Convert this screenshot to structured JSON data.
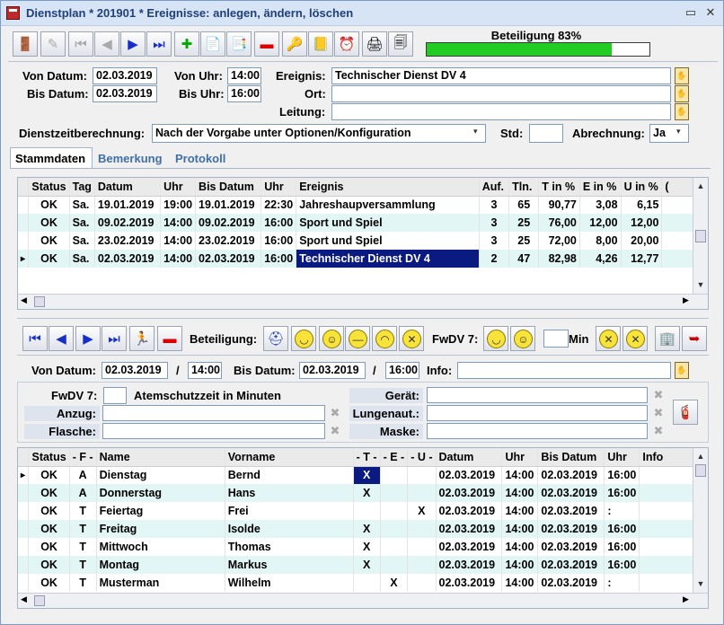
{
  "window": {
    "title": "Dienstplan * 201901 * Ereignisse: anlegen, ändern, löschen",
    "minimize": "▭",
    "close": "✕"
  },
  "toolbar": {
    "progress_label": "Beteiligung 83%",
    "progress_value": 0.83,
    "progress_color": "#22cc22"
  },
  "form": {
    "von_datum_label": "Von Datum:",
    "von_datum": "02.03.2019",
    "bis_datum_label": "Bis Datum:",
    "bis_datum": "02.03.2019",
    "von_uhr_label": "Von Uhr:",
    "von_uhr": "14:00",
    "bis_uhr_label": "Bis Uhr:",
    "bis_uhr": "16:00",
    "ereignis_label": "Ereignis:",
    "ereignis": "Technischer Dienst DV 4",
    "ort_label": "Ort:",
    "ort": "",
    "leitung_label": "Leitung:",
    "leitung": "",
    "dienstzeit_label": "Dienstzeitberechnung:",
    "dienstzeit": "Nach der Vorgabe unter Optionen/Konfiguration",
    "std_label": "Std:",
    "std": "",
    "abrechnung_label": "Abrechnung:",
    "abrechnung": "Ja"
  },
  "tabs": [
    "Stammdaten",
    "Bemerkung",
    "Protokoll"
  ],
  "events": {
    "headers": [
      "Status",
      "Tag",
      "Datum",
      "Uhr",
      "Bis Datum",
      "Uhr",
      "Ereignis",
      "Auf.",
      "Tln.",
      "T in %",
      "E in %",
      "U in %",
      "("
    ],
    "rows": [
      [
        "OK",
        "Sa.",
        "19.01.2019",
        "19:00",
        "19.01.2019",
        "22:30",
        "Jahreshaupversammlung",
        "3",
        "65",
        "90,77",
        "3,08",
        "6,15"
      ],
      [
        "OK",
        "Sa.",
        "09.02.2019",
        "14:00",
        "09.02.2019",
        "16:00",
        "Sport und Spiel",
        "3",
        "25",
        "76,00",
        "12,00",
        "12,00"
      ],
      [
        "OK",
        "Sa.",
        "23.02.2019",
        "14:00",
        "23.02.2019",
        "16:00",
        "Sport und Spiel",
        "3",
        "25",
        "72,00",
        "8,00",
        "20,00"
      ],
      [
        "OK",
        "Sa.",
        "02.03.2019",
        "14:00",
        "02.03.2019",
        "16:00",
        "Technischer Dienst DV 4",
        "2",
        "47",
        "82,98",
        "4,26",
        "12,77"
      ]
    ]
  },
  "toolbar2": {
    "beteiligung_label": "Beteiligung:",
    "fwdv_label": "FwDV 7:",
    "min_label": "Min"
  },
  "detail": {
    "von_datum_label": "Von Datum:",
    "von_datum": "02.03.2019",
    "slash": "/",
    "von_uhr": "14:00",
    "bis_datum_label": "Bis Datum:",
    "bis_datum": "02.03.2019",
    "bis_uhr": "16:00",
    "info_label": "Info:",
    "info": "",
    "fwdv_label": "FwDV 7:",
    "fwdv": "",
    "atemschutz_label": "Atemschutzzeit in Minuten",
    "geraet_label": "Gerät:",
    "anzug_label": "Anzug:",
    "lungen_label": "Lungenaut.:",
    "flasche_label": "Flasche:",
    "maske_label": "Maske:"
  },
  "participants": {
    "headers": [
      "Status",
      "- F -",
      "Name",
      "Vorname",
      "- T -",
      "- E -",
      "- U -",
      "Datum",
      "Uhr",
      "Bis Datum",
      "Uhr",
      "Info"
    ],
    "rows": [
      [
        "OK",
        "A",
        "Dienstag",
        "Bernd",
        "X",
        "",
        "",
        "02.03.2019",
        "14:00",
        "02.03.2019",
        "16:00",
        ""
      ],
      [
        "OK",
        "A",
        "Donnerstag",
        "Hans",
        "X",
        "",
        "",
        "02.03.2019",
        "14:00",
        "02.03.2019",
        "16:00",
        ""
      ],
      [
        "OK",
        "T",
        "Feiertag",
        "Frei",
        "",
        "",
        "X",
        "02.03.2019",
        "14:00",
        "02.03.2019",
        ":",
        ""
      ],
      [
        "OK",
        "T",
        "Freitag",
        "Isolde",
        "X",
        "",
        "",
        "02.03.2019",
        "14:00",
        "02.03.2019",
        "16:00",
        ""
      ],
      [
        "OK",
        "T",
        "Mittwoch",
        "Thomas",
        "X",
        "",
        "",
        "02.03.2019",
        "14:00",
        "02.03.2019",
        "16:00",
        ""
      ],
      [
        "OK",
        "T",
        "Montag",
        "Markus",
        "X",
        "",
        "",
        "02.03.2019",
        "14:00",
        "02.03.2019",
        "16:00",
        ""
      ],
      [
        "OK",
        "T",
        "Musterman",
        "Wilhelm",
        "",
        "X",
        "",
        "02.03.2019",
        "14:00",
        "02.03.2019",
        ":",
        ""
      ]
    ]
  }
}
